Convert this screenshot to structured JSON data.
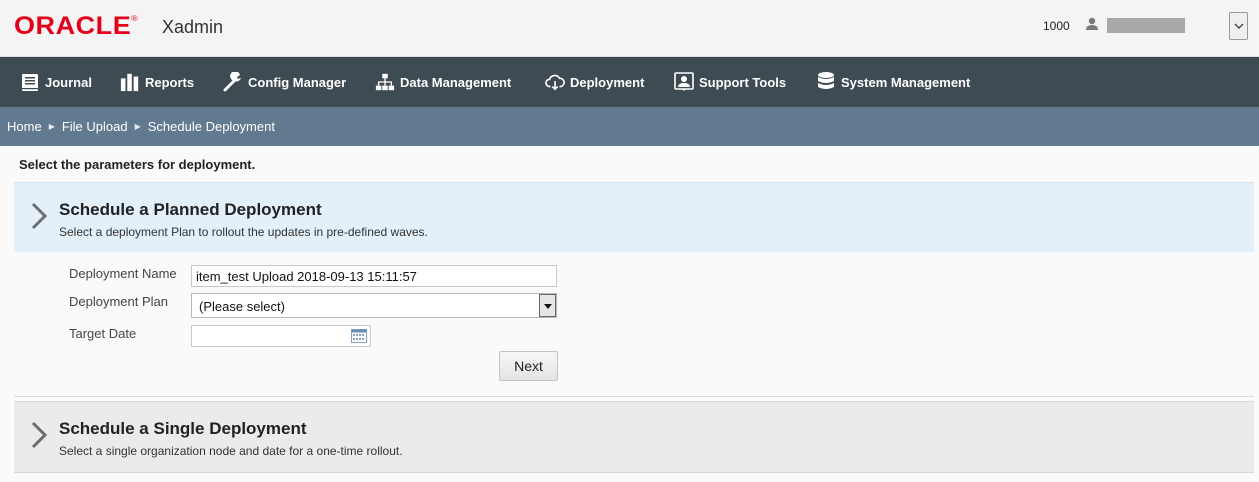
{
  "header": {
    "logo_text": "ORACLE",
    "app_name": "Xadmin",
    "org_id": "1000",
    "icons": {
      "user": "user-icon",
      "dropdown": "chevron-down-icon"
    }
  },
  "nav": {
    "items": [
      {
        "label": "Journal",
        "icon": "journal-icon"
      },
      {
        "label": "Reports",
        "icon": "bar-chart-icon"
      },
      {
        "label": "Config Manager",
        "icon": "wrench-icon"
      },
      {
        "label": "Data Management",
        "icon": "hierarchy-icon"
      },
      {
        "label": "Deployment",
        "icon": "cloud-download-icon"
      },
      {
        "label": "Support Tools",
        "icon": "support-icon"
      },
      {
        "label": "System Management",
        "icon": "database-icon"
      }
    ]
  },
  "breadcrumb": {
    "items": [
      "Home",
      "File Upload",
      "Schedule Deployment"
    ]
  },
  "instructions": "Select the parameters for deployment.",
  "planned": {
    "title": "Schedule a Planned Deployment",
    "description": "Select a deployment Plan to rollout the updates in pre-defined waves.",
    "form": {
      "name_label": "Deployment Name",
      "name_value": "item_test Upload 2018-09-13 15:11:57",
      "plan_label": "Deployment Plan",
      "plan_value": "(Please select)",
      "date_label": "Target Date",
      "date_value": "",
      "next_label": "Next"
    }
  },
  "single": {
    "title": "Schedule a Single Deployment",
    "description": "Select a single organization node and date for a one-time rollout."
  },
  "colors": {
    "brand_red": "#e2001a",
    "nav_bg": "#3f4b52",
    "breadcrumb_bg": "#627a8f",
    "panel_active_bg": "#e3eff9",
    "panel_inactive_bg": "#ebebeb"
  }
}
